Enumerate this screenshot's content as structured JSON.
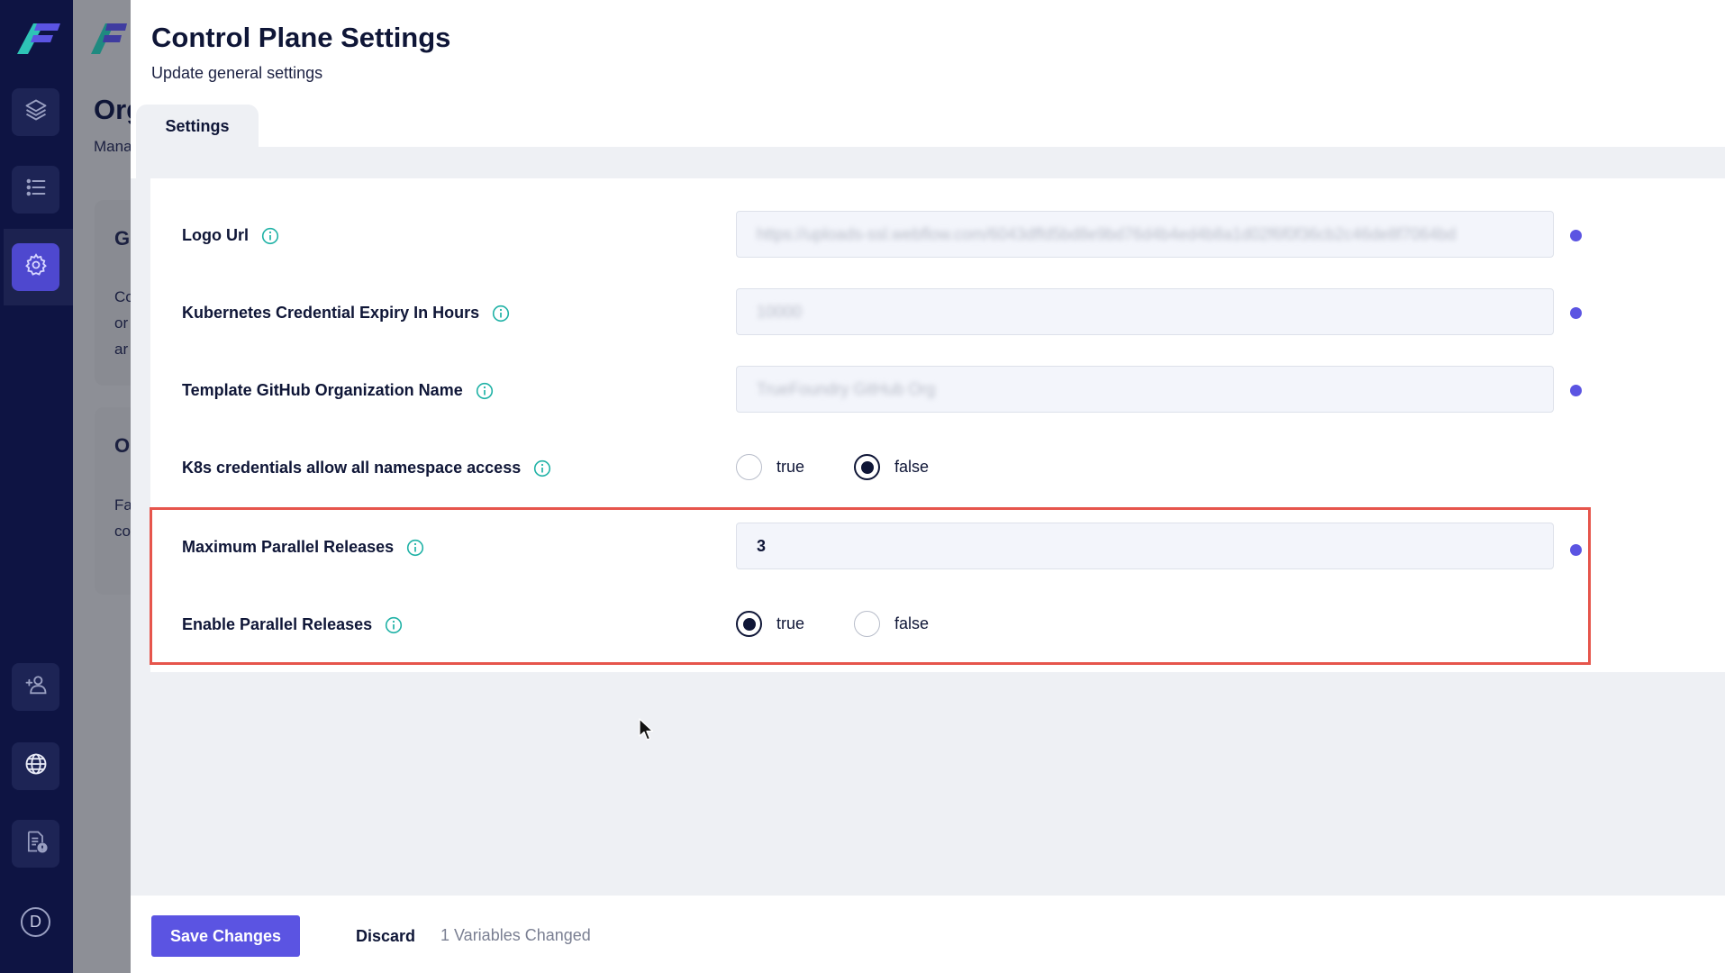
{
  "rail": {
    "avatar_letter": "D",
    "items": [
      "layers-icon",
      "list-icon",
      "settings-icon",
      "add-user-icon",
      "globe-icon",
      "document-alert-icon"
    ]
  },
  "background_page": {
    "title": "Org",
    "subtitle": "Mana",
    "card1_heading": "G",
    "card1_lines": [
      "Co",
      "or",
      "ar"
    ],
    "card2_heading": "O",
    "card2_lines": [
      "Fa",
      "co"
    ]
  },
  "modal": {
    "title": "Control Plane Settings",
    "subtitle": "Update general settings",
    "tab_label": "Settings"
  },
  "settings": {
    "logo_url": {
      "label": "Logo Url",
      "value": "https://uploads-ssl.webflow.com/6043dffd5bd8e9bd76d4b4ed4b8a1d02f6f0f36cb2c46de8f7064bd"
    },
    "k8s_expiry": {
      "label": "Kubernetes Credential Expiry In Hours",
      "value": "10000"
    },
    "template_org": {
      "label": "Template GitHub Organization Name",
      "value": "TrueFoundry GitHub Org"
    },
    "namespace_access": {
      "label": "K8s credentials allow all namespace access",
      "options": [
        "true",
        "false"
      ],
      "selected": "false"
    },
    "max_parallel": {
      "label": "Maximum Parallel Releases",
      "value": "3"
    },
    "enable_parallel": {
      "label": "Enable Parallel Releases",
      "options": [
        "true",
        "false"
      ],
      "selected": "true"
    }
  },
  "footer": {
    "save_label": "Save Changes",
    "discard_label": "Discard",
    "changed_text": "1 Variables Changed"
  },
  "colors": {
    "accent": "#5b54e2",
    "rail": "#0e1443",
    "highlight": "#e6554c"
  }
}
